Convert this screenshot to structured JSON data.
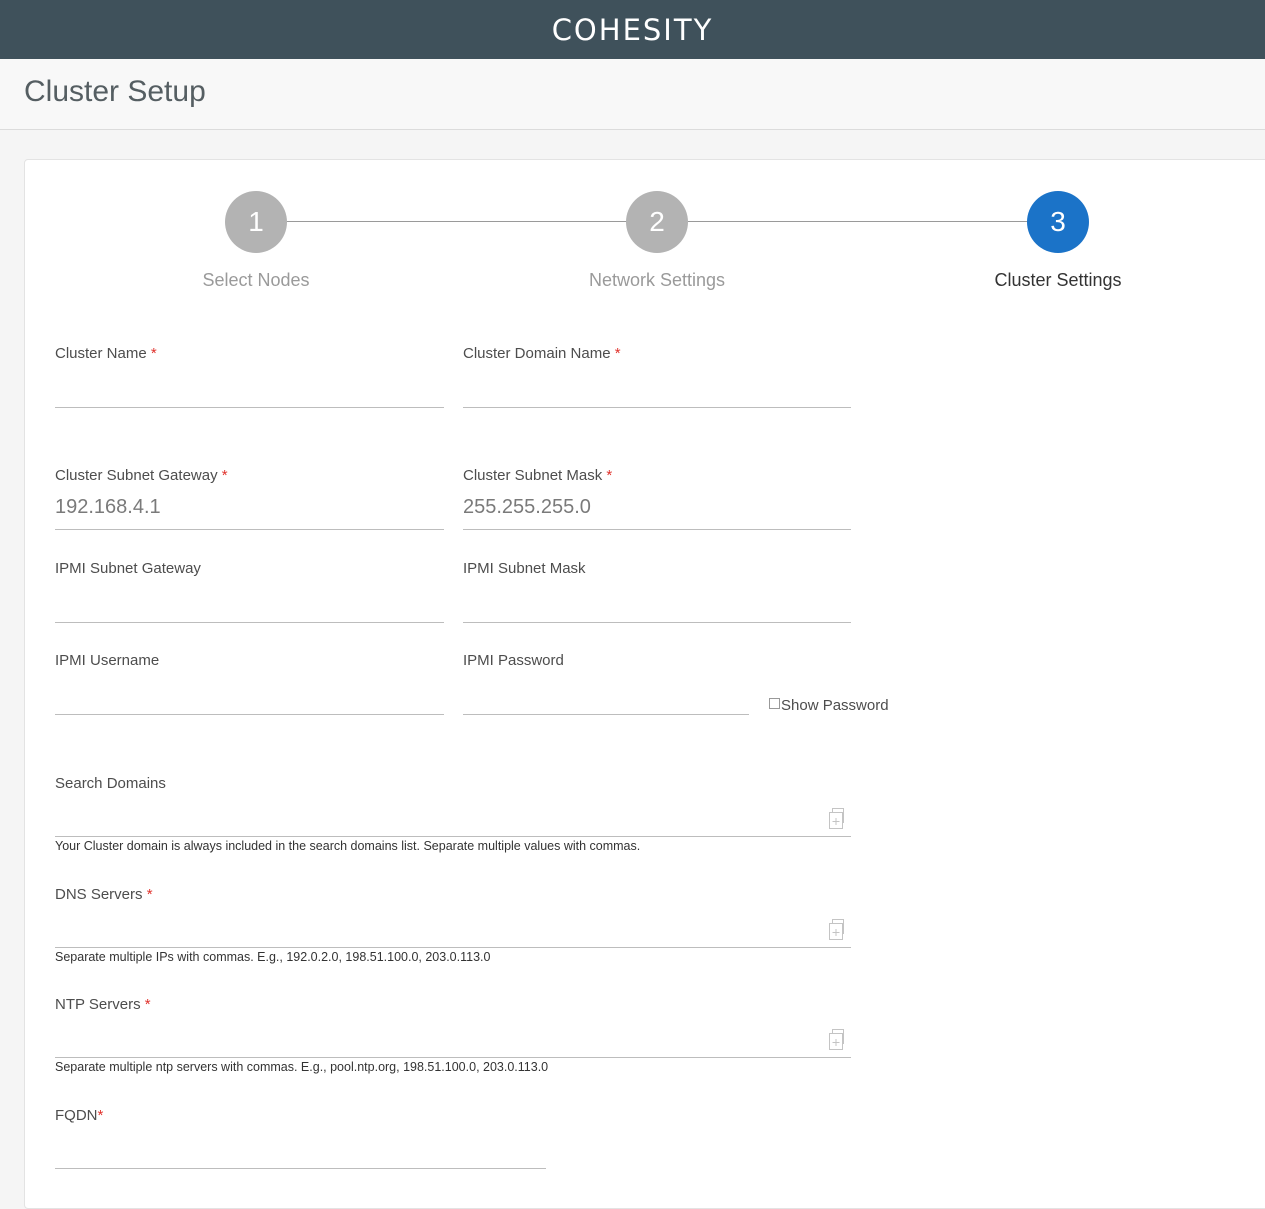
{
  "brand": "COHESITY",
  "page_title": "Cluster Setup",
  "steps": [
    {
      "number": "1",
      "label": "Select Nodes",
      "active": false
    },
    {
      "number": "2",
      "label": "Network Settings",
      "active": false
    },
    {
      "number": "3",
      "label": "Cluster Settings",
      "active": true
    }
  ],
  "fields": {
    "cluster_name": {
      "label": "Cluster Name",
      "required": "*",
      "value": ""
    },
    "cluster_domain_name": {
      "label": "Cluster Domain Name",
      "required": "*",
      "value": ""
    },
    "cluster_subnet_gateway": {
      "label": "Cluster Subnet Gateway",
      "required": "*",
      "value": "192.168.4.1"
    },
    "cluster_subnet_mask": {
      "label": "Cluster Subnet Mask",
      "required": "*",
      "value": "255.255.255.0"
    },
    "ipmi_subnet_gateway": {
      "label": "IPMI Subnet Gateway",
      "value": ""
    },
    "ipmi_subnet_mask": {
      "label": "IPMI Subnet Mask",
      "value": ""
    },
    "ipmi_username": {
      "label": "IPMI Username",
      "value": ""
    },
    "ipmi_password": {
      "label": "IPMI Password",
      "value": ""
    },
    "show_password": {
      "label": "Show Password",
      "checked": false
    },
    "search_domains": {
      "label": "Search Domains",
      "value": "",
      "helper": "Your Cluster domain is always included in the search domains list. Separate multiple values with commas."
    },
    "dns_servers": {
      "label": "DNS Servers",
      "required": "*",
      "value": "",
      "helper": "Separate multiple IPs with commas. E.g., 192.0.2.0, 198.51.100.0, 203.0.113.0"
    },
    "ntp_servers": {
      "label": "NTP Servers",
      "required": "*",
      "value": "",
      "helper": "Separate multiple ntp servers with commas. E.g., pool.ntp.org, 198.51.100.0, 203.0.113.0"
    },
    "fqdn": {
      "label": "FQDN",
      "required": "*",
      "value": ""
    }
  },
  "colors": {
    "topbar": "#3f515b",
    "active_step": "#1b73c8",
    "inactive_step": "#b3b3b3",
    "required": "#e0312b"
  },
  "icons": {
    "paste": "copy-paste-icon"
  }
}
